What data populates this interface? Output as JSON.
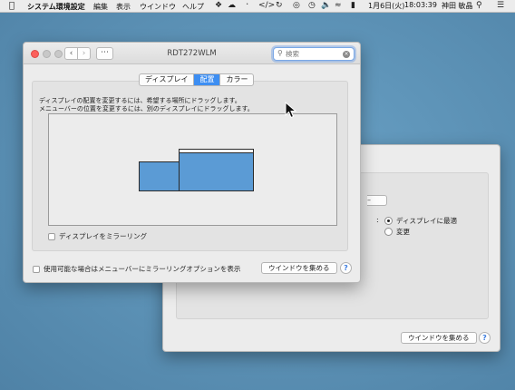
{
  "menubar": {
    "app_name": "システム環境設定",
    "menus": [
      "編集",
      "表示",
      "ウインドウ",
      "ヘルプ"
    ],
    "date": "1月6日(火)",
    "time": "18:03:39",
    "user": "神田 敏晶"
  },
  "front_window": {
    "title": "RDT272WLM",
    "search_placeholder": "検索",
    "tabs": [
      {
        "label": "ディスプレイ",
        "active": false
      },
      {
        "label": "配置",
        "active": true
      },
      {
        "label": "カラー",
        "active": false
      }
    ],
    "description_line1": "ディスプレイの配置を変更するには、希望する場所にドラッグします。",
    "description_line2": "メニューバーの位置を変更するには、別のディスプレイにドラッグします。",
    "mirror_label": "ディスプレイをミラーリング",
    "mirror_checked": false,
    "show_mirroring_label": "使用可能な場合はメニューバーにミラーリングオプションを表示",
    "show_mirroring_checked": false,
    "gather_windows_label": "ウインドウを集める",
    "help_label": "?"
  },
  "back_window": {
    "radio_options": [
      {
        "label": "ディスプレイに最適",
        "selected": true
      },
      {
        "label": "変更",
        "selected": false
      }
    ],
    "gather_windows_label": "ウインドウを集める",
    "help_label": "?"
  },
  "colors": {
    "accent": "#3d8ef2",
    "display_fill": "#5b9bd5",
    "desktop": "#5f95b9",
    "close_button": "#fc605c"
  }
}
